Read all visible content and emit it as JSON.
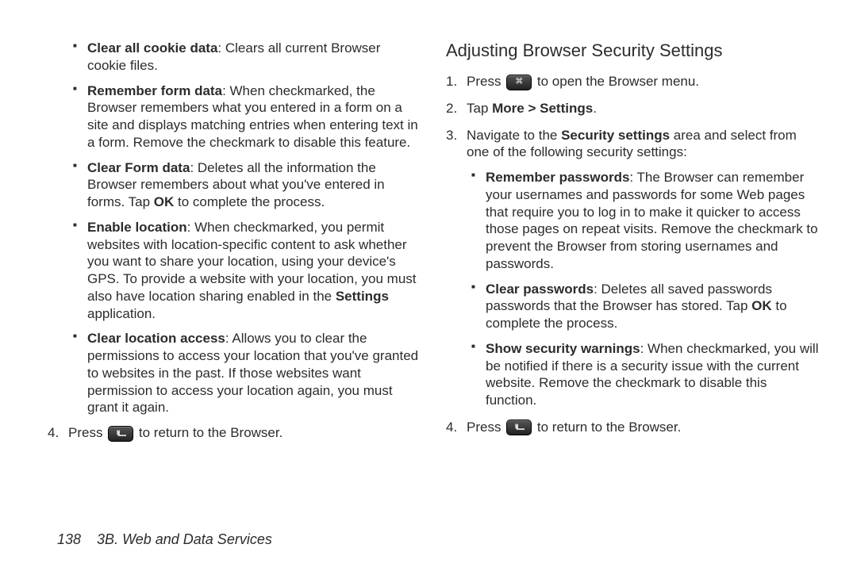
{
  "left": {
    "bullets": [
      {
        "label": "Clear all cookie data",
        "text": ": Clears all current Browser cookie files."
      },
      {
        "label": "Remember form data",
        "text": ": When checkmarked, the Browser remembers what you entered in a form on a site and displays matching entries when entering text in a form. Remove the checkmark to disable this feature."
      },
      {
        "label": "Clear Form data",
        "pre": ": Deletes all the information the Browser remembers about what you've entered in forms. Tap ",
        "bold_mid": "OK",
        "post": " to complete the process."
      },
      {
        "label": "Enable location",
        "pre": ": When checkmarked, you permit websites with location-specific content to ask whether you want to share your location, using your device's GPS. To provide a website with your location, you must also have location sharing enabled in the ",
        "bold_mid": "Settings",
        "post": " application."
      },
      {
        "label": "Clear location access",
        "text": ": Allows you to clear the permissions to access your location that you've granted to websites in the past. If those websites want permission to access your location again, you must grant it again."
      }
    ],
    "step4_pre": "Press ",
    "step4_post": " to return to the Browser."
  },
  "right": {
    "heading": "Adjusting Browser Security Settings",
    "step1_pre": "Press ",
    "step1_post": " to open the Browser menu.",
    "step2_pre": "Tap ",
    "step2_bold": "More > Settings",
    "step2_post": ".",
    "step3_pre": "Navigate to the ",
    "step3_bold": "Security settings",
    "step3_post": " area and select from one of the following security settings:",
    "bullets": [
      {
        "label": "Remember passwords",
        "text": ": The Browser can remember your usernames and passwords for some Web pages that require you to log in to make it quicker to access those pages on repeat visits. Remove the checkmark to prevent the Browser from storing usernames and passwords."
      },
      {
        "label": "Clear passwords",
        "pre": ": Deletes all saved passwords passwords that the Browser has stored. Tap ",
        "bold_mid": "OK",
        "post": " to complete the process."
      },
      {
        "label": "Show security warnings",
        "text": ": When checkmarked, you will be notified if there is a security issue with the current website. Remove the checkmark to disable this function."
      }
    ],
    "step4_pre": "Press ",
    "step4_post": " to return to the Browser."
  },
  "footer": {
    "page": "138",
    "section": "3B. Web and Data Services"
  }
}
